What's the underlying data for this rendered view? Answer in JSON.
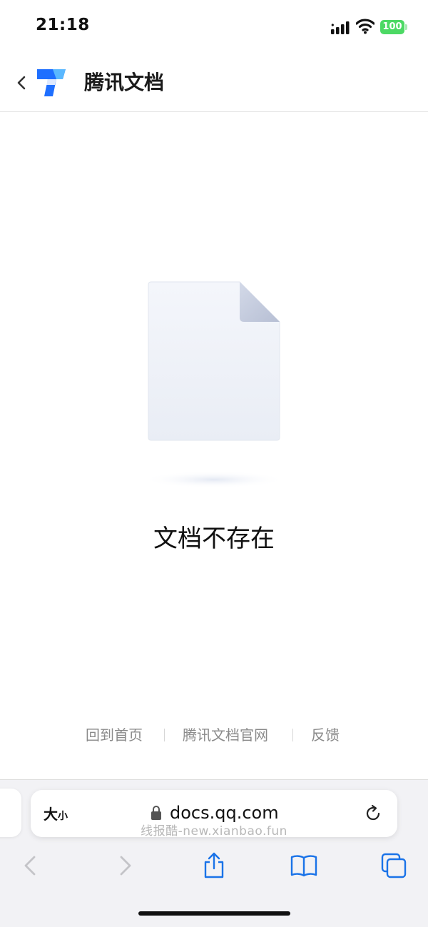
{
  "status_bar": {
    "time": "21:18",
    "battery": "100",
    "icons": [
      "signal-icon",
      "wifi-icon",
      "battery-icon"
    ],
    "battery_color": "#4cd964"
  },
  "header": {
    "back_icon": "chevron-left-icon",
    "logo_icon": "tencent-docs-logo-icon",
    "title": "腾讯文档"
  },
  "empty_state": {
    "illustration_icon": "blank-document-icon",
    "message": "文档不存在"
  },
  "footer": {
    "links": [
      "回到首页",
      "腾讯文档官网",
      "反馈"
    ]
  },
  "browser": {
    "text_size_big": "大",
    "text_size_small": "小",
    "lock_icon": "lock-icon",
    "url": "docs.qq.com",
    "reload_icon": "reload-icon",
    "watermark": "线报酷-new.xianbao.fun",
    "toolbar_icons": [
      "back-icon",
      "forward-icon",
      "share-icon",
      "bookmarks-icon",
      "tabs-icon"
    ],
    "accent_color": "#1a73e8"
  }
}
